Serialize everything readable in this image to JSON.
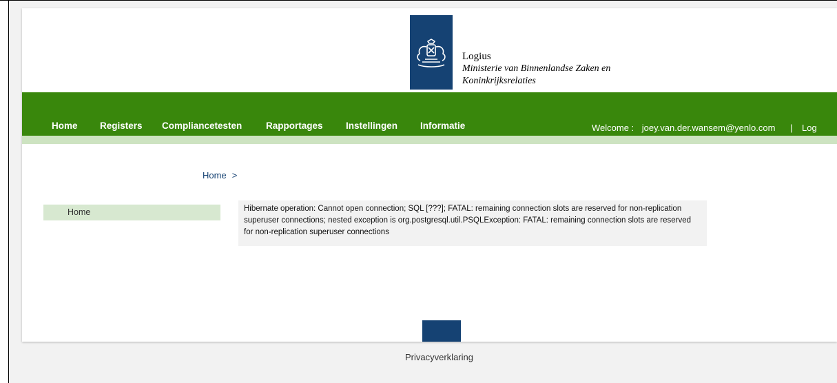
{
  "brand": {
    "name": "Logius",
    "ministry_line1": "Ministerie van Binnenlandse Zaken en",
    "ministry_line2": "Koninkrijksrelaties"
  },
  "nav": {
    "items": [
      {
        "label": "Home"
      },
      {
        "label": "Registers"
      },
      {
        "label": "Compliancetesten"
      },
      {
        "label": "Rapportages"
      },
      {
        "label": "Instellingen"
      },
      {
        "label": "Informatie"
      }
    ],
    "welcome_label": "Welcome :",
    "user_email": "joey.van.der.wansem@yenlo.com",
    "separator": "|",
    "logout_label": "Log"
  },
  "breadcrumb": {
    "home": "Home",
    "separator": ">"
  },
  "sidebar": {
    "home": "Home"
  },
  "error": {
    "message": "Hibernate operation: Cannot open connection; SQL [???]; FATAL: remaining connection slots are reserved for non-replication superuser connections; nested exception is org.postgresql.util.PSQLException: FATAL: remaining connection slots are reserved for non-replication superuser connections"
  },
  "footer": {
    "privacy": "Privacyverklaring"
  },
  "colors": {
    "nav_green": "#39870c",
    "nav_strip": "#cde3c1",
    "brand_blue": "#154273",
    "sidebar_highlight": "#d7e8d0"
  }
}
